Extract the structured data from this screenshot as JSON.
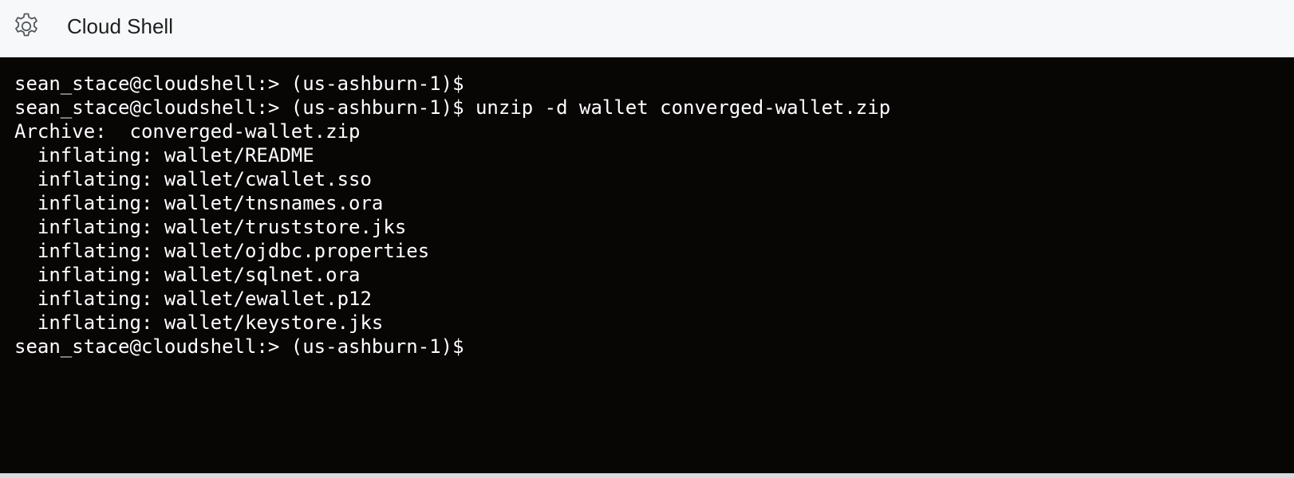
{
  "header": {
    "title": "Cloud Shell",
    "settings_icon": "gear-icon"
  },
  "colors": {
    "header_background": "#f7f8fa",
    "terminal_background": "#080505",
    "terminal_text": "#ffffff"
  },
  "terminal": {
    "lines": [
      "sean_stace@cloudshell:> (us-ashburn-1)$",
      "sean_stace@cloudshell:> (us-ashburn-1)$ unzip -d wallet converged-wallet.zip",
      "Archive:  converged-wallet.zip",
      "  inflating: wallet/README",
      "  inflating: wallet/cwallet.sso",
      "  inflating: wallet/tnsnames.ora",
      "  inflating: wallet/truststore.jks",
      "  inflating: wallet/ojdbc.properties",
      "  inflating: wallet/sqlnet.ora",
      "  inflating: wallet/ewallet.p12",
      "  inflating: wallet/keystore.jks",
      "sean_stace@cloudshell:> (us-ashburn-1)$"
    ]
  }
}
